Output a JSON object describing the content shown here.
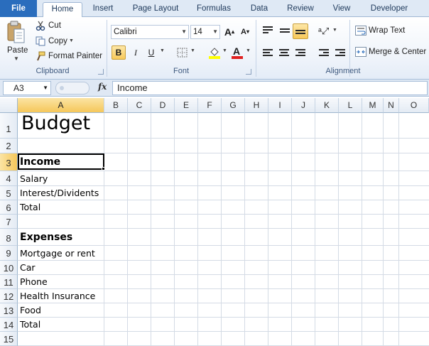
{
  "tabs": [
    "File",
    "Home",
    "Insert",
    "Page Layout",
    "Formulas",
    "Data",
    "Review",
    "View",
    "Developer"
  ],
  "active_tab": "Home",
  "clipboard": {
    "paste": "Paste",
    "cut": "Cut",
    "copy": "Copy",
    "format_painter": "Format Painter",
    "label": "Clipboard"
  },
  "font": {
    "name": "Calibri",
    "size": "14",
    "bold": "B",
    "italic": "I",
    "underline": "U",
    "label": "Font"
  },
  "alignment": {
    "wrap_text": "Wrap Text",
    "merge_center": "Merge & Center",
    "label": "Alignment"
  },
  "formula_bar": {
    "name_box": "A3",
    "fx": "fx",
    "value": "Income"
  },
  "columns": [
    "A",
    "B",
    "C",
    "D",
    "E",
    "F",
    "G",
    "H",
    "I",
    "J",
    "K",
    "L",
    "M",
    "N",
    "O"
  ],
  "rows": [
    "1",
    "2",
    "3",
    "4",
    "5",
    "6",
    "7",
    "8",
    "9",
    "10",
    "11",
    "12",
    "13",
    "14",
    "15"
  ],
  "cells": {
    "A1": "Budget",
    "A3": "Income",
    "A4": "Salary",
    "A5": "Interest/Dividents",
    "A6": "Total",
    "A8": "Expenses",
    "A9": "Mortgage or rent",
    "A10": "Car",
    "A11": "Phone",
    "A12": "Health Insurance",
    "A13": "Food",
    "A14": "Total"
  },
  "selected_cell": "A3",
  "colors": {
    "file_tab": "#2a6dbd",
    "selection_header": "#f5c75a",
    "ribbon_bg": "#eef3fa"
  }
}
